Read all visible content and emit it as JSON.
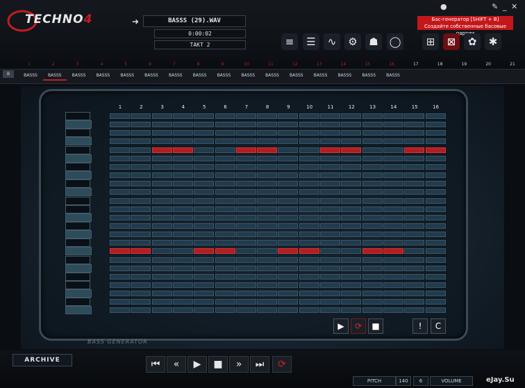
{
  "app": {
    "logo_text": "TECHNO",
    "logo_version": "4"
  },
  "window_controls": {
    "settings_icon": "wrench-icon",
    "minimize": "_",
    "close": "✕"
  },
  "header": {
    "arrow_icon": "arrow-right-icon",
    "file_name": "BASSS (29).WAV",
    "time": "0:00:02",
    "takt": "TAKT 2",
    "red_status": ""
  },
  "tooltip": {
    "line1": "Бас-генератор [SHIFT + B]",
    "line2": "Создайте собственные басовые партии"
  },
  "toolbar": {
    "tools": [
      {
        "icon": "list-icon",
        "glyph": "≡"
      },
      {
        "icon": "list-rows-icon",
        "glyph": "☰"
      },
      {
        "icon": "waveform-icon",
        "glyph": "∿"
      },
      {
        "icon": "gear-icon",
        "glyph": "⚙"
      },
      {
        "icon": "robot-icon",
        "glyph": "☗"
      },
      {
        "icon": "record-circle-icon",
        "glyph": "◯"
      }
    ],
    "generators": [
      {
        "icon": "groove-generator-icon",
        "glyph": "⊞",
        "active": false
      },
      {
        "icon": "bass-generator-icon",
        "glyph": "⊠",
        "active": true
      },
      {
        "icon": "gear-generator-icon",
        "glyph": "✿",
        "active": false
      },
      {
        "icon": "melody-generator-icon",
        "glyph": "✱",
        "active": false
      }
    ]
  },
  "timeline_numbers": [
    "1",
    "2",
    "3",
    "4",
    "5",
    "6",
    "7",
    "8",
    "9",
    "10",
    "11",
    "12",
    "13",
    "14",
    "15",
    "16",
    "17",
    "18",
    "19",
    "20",
    "21"
  ],
  "pattern_row": {
    "button_label": "B",
    "slots": [
      "BASSS",
      "BASSS",
      "BASSS",
      "BASSS",
      "BASSS",
      "BASSS",
      "BASSS",
      "BASSS",
      "BASSS",
      "BASSS",
      "BASSS",
      "BASSS",
      "BASSS",
      "BASSS",
      "BASSS",
      "BASSS"
    ],
    "selected_index": 1
  },
  "sequencer": {
    "columns": [
      "1",
      "2",
      "3",
      "4",
      "5",
      "6",
      "7",
      "8",
      "9",
      "10",
      "11",
      "12",
      "13",
      "14",
      "15",
      "16"
    ],
    "rows": 24,
    "active_cells": [
      {
        "row": 5,
        "cols": [
          3,
          4,
          7,
          8,
          11,
          12,
          15,
          16
        ]
      },
      {
        "row": 17,
        "cols": [
          1,
          2,
          5,
          6,
          9,
          10,
          13,
          14
        ]
      }
    ]
  },
  "panel_buttons": {
    "play": "▶",
    "loop": "⟳",
    "stop": "■",
    "clear_icon": "warning-icon",
    "clear": "!",
    "copy": "C"
  },
  "panel_label": "BASS GENERATOR",
  "bottom": {
    "archive": "ARCHIVE",
    "transport": [
      {
        "name": "skip-start-icon",
        "glyph": "⏮"
      },
      {
        "name": "rewind-icon",
        "glyph": "«"
      },
      {
        "name": "play-icon",
        "glyph": "▶"
      },
      {
        "name": "stop-icon",
        "glyph": "■"
      },
      {
        "name": "fast-forward-icon",
        "glyph": "»"
      },
      {
        "name": "skip-end-icon",
        "glyph": "⏭"
      },
      {
        "name": "loop-icon",
        "glyph": "⟳"
      }
    ],
    "pitch_label": "PITCH",
    "pitch_value": "140",
    "volume_value": "6",
    "volume_label": "VOLUME",
    "watermark": "eJay.Su"
  },
  "colors": {
    "accent_red": "#c4171b",
    "cell_off": "#223b4c",
    "cell_on": "#b01e22"
  }
}
